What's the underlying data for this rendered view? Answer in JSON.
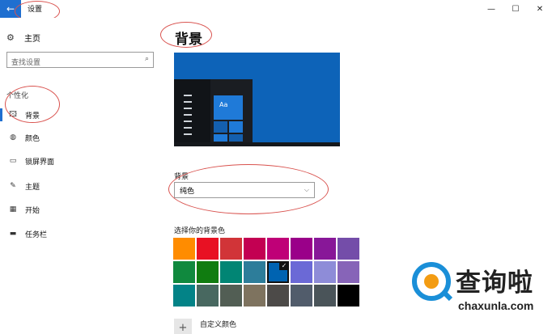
{
  "window": {
    "title": "设置",
    "back_icon": "←",
    "controls": {
      "minimize": "—",
      "maximize": "☐",
      "close": "✕"
    }
  },
  "sidebar": {
    "home": {
      "icon": "⚙",
      "label": "主页"
    },
    "search": {
      "placeholder": "查找设置",
      "icon": "⌕"
    },
    "section_title": "个性化",
    "items": [
      {
        "icon": "🖾",
        "label": "背景",
        "active": true
      },
      {
        "icon": "◍",
        "label": "颜色"
      },
      {
        "icon": "▭",
        "label": "锁屏界面"
      },
      {
        "icon": "✎",
        "label": "主题"
      },
      {
        "icon": "▦",
        "label": "开始"
      },
      {
        "icon": "▬",
        "label": "任务栏"
      }
    ]
  },
  "main": {
    "title": "背景",
    "preview": {
      "tile_text": "Aa",
      "background_color": "#0d63b8"
    },
    "background": {
      "label": "背景",
      "selected": "纯色",
      "chevron": "⌵"
    },
    "color_label": "选择你的背景色",
    "swatches": [
      [
        "#ff8c00",
        "#e81123",
        "#d13438",
        "#c30052",
        "#bf0077",
        "#9a0089",
        "#881798",
        "#744da9"
      ],
      [
        "#10893e",
        "#107c10",
        "#018574",
        "#2d7d9a",
        "#0063b1",
        "#6b69d6",
        "#8e8cd8",
        "#8764b8"
      ],
      [
        "#038387",
        "#486860",
        "#525e54",
        "#7e735f",
        "#4c4a48",
        "#515c6b",
        "#4a5459",
        "#000000"
      ]
    ],
    "selected_swatch": {
      "row": 1,
      "col": 4,
      "check": "✓"
    },
    "custom_color": {
      "icon": "+",
      "label": "自定义颜色"
    }
  },
  "watermark": {
    "text": "查询啦",
    "url": "chaxunla.com"
  }
}
